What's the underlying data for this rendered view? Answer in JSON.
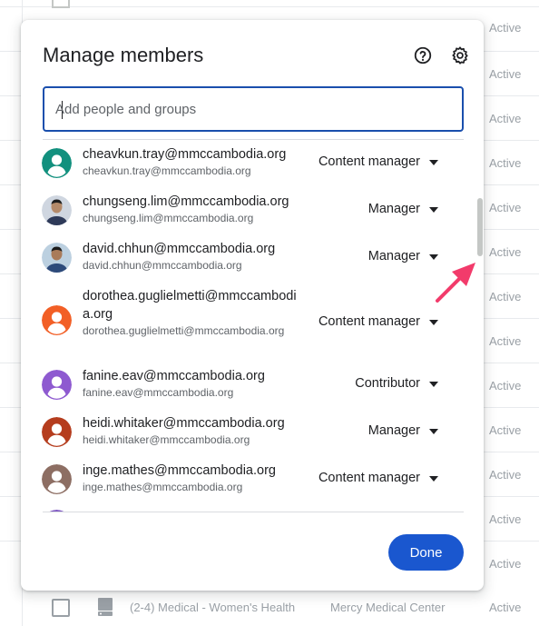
{
  "background": {
    "rows": [
      {
        "status": "Active"
      },
      {
        "status": "Active"
      },
      {
        "status": "Active"
      },
      {
        "status": "Active"
      },
      {
        "status": "Active"
      },
      {
        "status": "Active"
      },
      {
        "status": "Active"
      },
      {
        "status": "Active"
      },
      {
        "status": "Active"
      },
      {
        "status": "Active"
      },
      {
        "status": "Active"
      },
      {
        "status": "Active"
      },
      {
        "status": "Active"
      }
    ],
    "last_row": {
      "name": "(2-4) Medical - Women's Health",
      "org": "Mercy Medical Center",
      "status": "Active"
    }
  },
  "dialog": {
    "title": "Manage members",
    "help_icon": "help-circle-icon",
    "settings_icon": "gear-icon",
    "search_placeholder": "Add people and groups",
    "done_label": "Done"
  },
  "members": [
    {
      "email": "cheavkun.tray@mmccambodia.org",
      "sub": "cheavkun.tray@mmccambodia.org",
      "role": "Content manager",
      "avatar_color": "#12907e"
    },
    {
      "email": "chungseng.lim@mmccambodia.org",
      "sub": "chungseng.lim@mmccambodia.org",
      "role": "Manager",
      "avatar_color": "#cfd6e0"
    },
    {
      "email": "david.chhun@mmccambodia.org",
      "sub": "david.chhun@mmccambodia.org",
      "role": "Manager",
      "avatar_color": "#bcd0e0"
    },
    {
      "email": "dorothea.guglielmetti@mmccambodia.org",
      "sub": "dorothea.guglielmetti@mmccambodia.org",
      "role": "Content manager",
      "avatar_color": "#f25f26"
    },
    {
      "email": "fanine.eav@mmccambodia.org",
      "sub": "fanine.eav@mmccambodia.org",
      "role": "Contributor",
      "avatar_color": "#8e5ad0"
    },
    {
      "email": "heidi.whitaker@mmccambodia.org",
      "sub": "heidi.whitaker@mmccambodia.org",
      "role": "Manager",
      "avatar_color": "#b53d1e"
    },
    {
      "email": "inge.mathes@mmccambodia.org",
      "sub": "inge.mathes@mmccambodia.org",
      "role": "Content manager",
      "avatar_color": "#8d6e63"
    }
  ],
  "colors": {
    "accent": "#1a57cf",
    "search_border": "#1a4fad",
    "annotation_arrow": "#f23b6b"
  }
}
